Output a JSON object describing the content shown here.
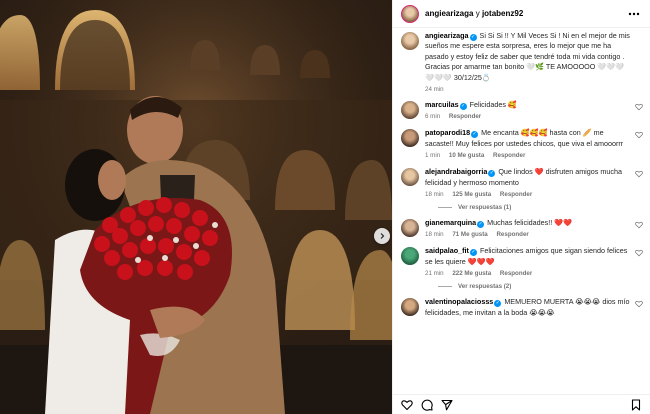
{
  "post": {
    "author": "angiearizaga",
    "conjunction": "y",
    "coauthor": "jotabenz92",
    "caption_author": "angiearizaga",
    "caption_text": "Si Si Si !! Y Mil Veces Si ! Ni en el mejor de mis sueños me espere esta sorpresa, eres lo mejor que me ha pasado y estoy feliz de saber que tendré toda mi vida contigo . Gracias por amarme tan bonito 🤍🌿 TE AMOOOOO 🤍🤍🤍🤍🤍🤍 30/12/25💍",
    "caption_time": "24 min"
  },
  "labels": {
    "reply": "Responder",
    "view_replies_1": "Ver respuestas (1)",
    "view_replies_2": "Ver respuestas (2)"
  },
  "comments": [
    {
      "user": "marcuilas",
      "verified": true,
      "text": "Felicidades 🥰",
      "time": "6 min",
      "likes": ""
    },
    {
      "user": "patoparodi18",
      "verified": true,
      "text": "Me encanta 🥰🥰🥰 hasta con 🥖 me sacaste!! Muy felices por ustedes chicos, que viva el amooorrr",
      "time": "1 min",
      "likes": "10 Me gusta"
    },
    {
      "user": "alejandrabaigorria",
      "verified": true,
      "text": "Que lindos ❤️ disfruten amigos mucha felicidad y hermoso momento",
      "time": "18 min",
      "likes": "125 Me gusta"
    },
    {
      "user": "gianemarquina",
      "verified": true,
      "text": "Muchas felicidades!! ❤️❤️",
      "time": "18 min",
      "likes": "71 Me gusta"
    },
    {
      "user": "saidpalao_fit",
      "verified": true,
      "text": "Felicitaciones amigos que sigan siendo felices se les quiere ❤️❤️❤️",
      "time": "21 min",
      "likes": "222 Me gusta"
    },
    {
      "user": "valentinopalaciosss",
      "verified": true,
      "text": "MEMUERO MUERTA 😭😭😭 dios mío felicidades, me invitan a la boda 😭😭😭",
      "time": "",
      "likes": ""
    }
  ],
  "icons": {
    "more": "more-horizontal-icon",
    "heart": "heart-outline-icon",
    "carousel_next": "chevron-right-icon",
    "like": "heart-icon",
    "comment": "comment-icon",
    "share": "send-icon",
    "save": "bookmark-icon"
  },
  "colors": {
    "verified": "#0095f6",
    "meta_gray": "#737373",
    "border": "#efefef"
  }
}
